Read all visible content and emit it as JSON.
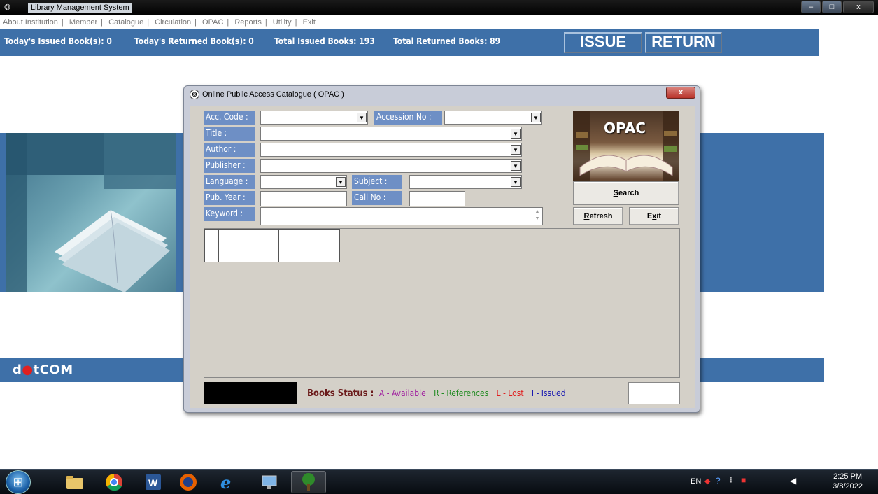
{
  "app": {
    "title": "Library Management System",
    "controls": {
      "minimize": "–",
      "maximize": "□",
      "close": "x"
    }
  },
  "menu": [
    "About Institution",
    "Member",
    "Catalogue",
    "Circulation",
    "OPAC",
    "Reports",
    "Utility",
    "Exit"
  ],
  "stats": {
    "todays_issued": "Today's Issued Book(s): 0",
    "todays_returned": "Today's Returned Book(s): 0",
    "total_issued": "Total Issued Books: 193",
    "total_returned": "Total Returned Books: 89"
  },
  "buttons": {
    "issue": "ISSUE",
    "return": "RETURN"
  },
  "brand": {
    "prefix": "d",
    "dot": "●",
    "suffix": "tCOM"
  },
  "dialog": {
    "title": "Online Public Access Catalogue ( OPAC )",
    "close": "x",
    "labels": {
      "acc_code": "Acc. Code :",
      "accession_no": "Accession No :",
      "title": "Title :",
      "author": "Author :",
      "publisher": "Publisher :",
      "language": "Language :",
      "subject": "Subject :",
      "pub_year": "Pub. Year :",
      "call_no": "Call No :",
      "keyword": "Keyword :"
    },
    "image_text": "OPAC",
    "search": {
      "key": "S",
      "rest": "earch"
    },
    "refresh": {
      "key": "R",
      "rest": "efresh"
    },
    "exit": {
      "pre": "E",
      "key": "x",
      "rest": "it"
    },
    "status": {
      "caption": "Books Status :",
      "available": "A - Available",
      "references": "R - References",
      "lost": "L - Lost",
      "issued": "I - Issued"
    }
  },
  "taskbar": {
    "lang": "EN",
    "time": "2:25 PM",
    "date": "3/8/2022"
  },
  "colors": {
    "banner": "#3e70a8",
    "label_bg": "#6e8fc5",
    "dialog_bg": "#d4d0c8"
  }
}
